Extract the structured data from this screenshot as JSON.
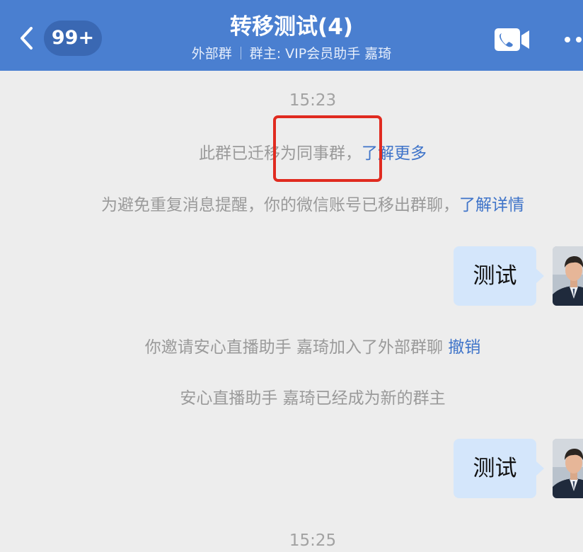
{
  "header": {
    "unread_count": "99+",
    "title": "转移测试(4)",
    "subtitle_tag": "外部群",
    "subtitle_owner": "群主: VIP会员助手 嘉琦"
  },
  "messages": {
    "time_1": "15:23",
    "sys_migrated_text": "此群已迁移为同事群，",
    "sys_migrated_link": "了解更多",
    "sys_removed_text": "为避免重复消息提醒，你的微信账号已移出群聊，",
    "sys_removed_link": "了解详情",
    "bubble_1": "测试",
    "sys_invite_text": "你邀请安心直播助手 嘉琦加入了外部群聊",
    "sys_invite_link": "撤销",
    "sys_owner_text": "安心直播助手 嘉琦已经成为新的群主",
    "bubble_2": "测试",
    "time_2": "15:25"
  },
  "colors": {
    "header_bg": "#4a7fd0",
    "link": "#3f74c9",
    "bubble_bg": "#d4e6fb",
    "highlight_border": "#e02b20"
  },
  "icons": {
    "back": "chevron-left-icon",
    "video": "video-call-icon",
    "more": "more-dots-icon"
  }
}
